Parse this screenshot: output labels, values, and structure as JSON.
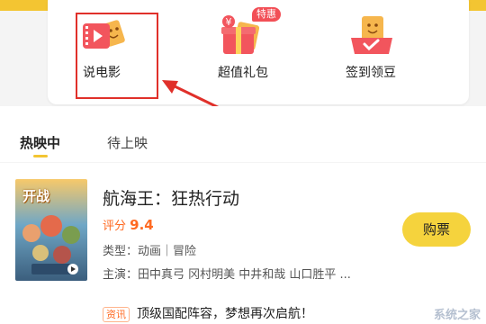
{
  "colors": {
    "accent": "#f3c532",
    "highlight": "#e0302a",
    "score": "#ff6a22"
  },
  "shortcuts": [
    {
      "label": "说电影",
      "icon": "film-icon"
    },
    {
      "label": "超值礼包",
      "icon": "gift-box-icon",
      "badge": "特惠",
      "badge_icon": "yen-tag-icon"
    },
    {
      "label": "签到领豆",
      "icon": "checkin-ticket-icon"
    }
  ],
  "tabs": [
    {
      "label": "热映中",
      "active": true
    },
    {
      "label": "待上映",
      "active": false
    }
  ],
  "movie": {
    "poster_text": "开战",
    "title": "航海王：狂热行动",
    "score_label": "评分",
    "score": "9.4",
    "type": "类型：动画｜冒险",
    "cast": "主演：田中真弓 冈村明美 中井和哉 山口胜平 ...",
    "buy_label": "购票"
  },
  "news": {
    "tag": "资讯",
    "text": "顶级国配阵容，梦想再次启航！"
  },
  "watermark": "系统之家"
}
